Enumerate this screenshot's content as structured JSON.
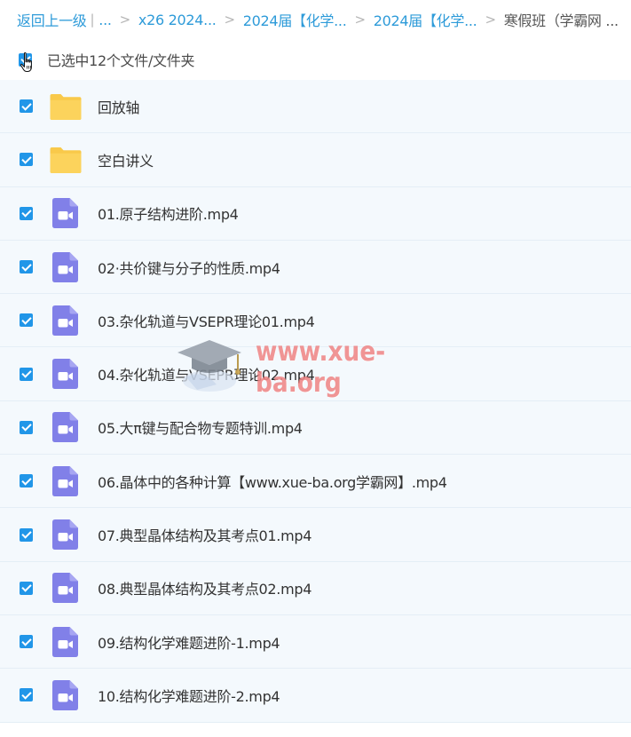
{
  "breadcrumb": {
    "back": "返回上一级",
    "divider": "|",
    "ellipsis": "...",
    "separator": ">",
    "items": [
      "x26 2024...",
      "2024届【化学...",
      "2024届【化学...",
      "寒假班（学霸网 ..."
    ]
  },
  "selection": {
    "text": "已选中12个文件/文件夹",
    "checked": true
  },
  "files": [
    {
      "type": "folder",
      "name": "回放轴",
      "checked": true
    },
    {
      "type": "folder",
      "name": "空白讲义",
      "checked": true
    },
    {
      "type": "video",
      "name": "01.原子结构进阶.mp4",
      "checked": true
    },
    {
      "type": "video",
      "name": "02·共价键与分子的性质.mp4",
      "checked": true
    },
    {
      "type": "video",
      "name": "03.杂化轨道与VSEPR理论01.mp4",
      "checked": true
    },
    {
      "type": "video",
      "name": "04.杂化轨道与VSEPR理论02.mp4",
      "checked": true
    },
    {
      "type": "video",
      "name": "05.大π键与配合物专题特训.mp4",
      "checked": true
    },
    {
      "type": "video",
      "name": "06.晶体中的各种计算【www.xue-ba.org学霸网】.mp4",
      "checked": true
    },
    {
      "type": "video",
      "name": "07.典型晶体结构及其考点01.mp4",
      "checked": true
    },
    {
      "type": "video",
      "name": "08.典型晶体结构及其考点02.mp4",
      "checked": true
    },
    {
      "type": "video",
      "name": "09.结构化学难题进阶-1.mp4",
      "checked": true
    },
    {
      "type": "video",
      "name": "10.结构化学难题进阶-2.mp4",
      "checked": true
    }
  ],
  "watermark": {
    "text": "www.xue-ba.org"
  },
  "colors": {
    "link": "#2e9bd9",
    "checkbox": "#2196e8",
    "folder": "#f9c94a",
    "video": "#8180e8",
    "row_background": "#f4f9fd",
    "watermark": "#ec6c6c"
  },
  "icons": {
    "folder": "folder-icon",
    "video": "video-file-icon",
    "checkbox": "checkbox-checked-icon",
    "cursor": "hand-cursor-icon"
  }
}
